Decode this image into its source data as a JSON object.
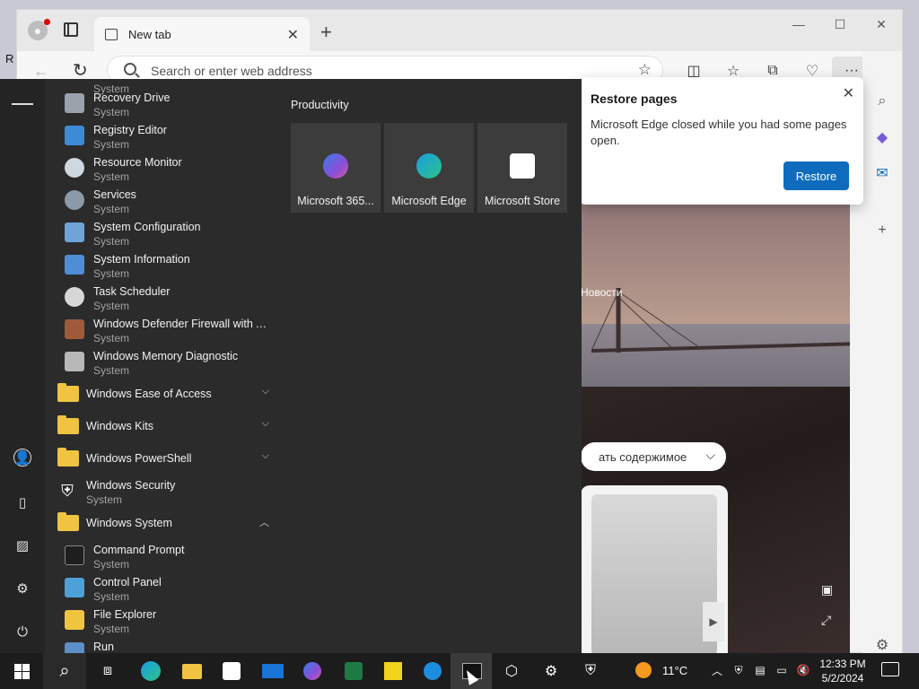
{
  "browser": {
    "tab_title": "New tab",
    "address_placeholder": "Search or enter web address",
    "content": {
      "news_label": "Новости",
      "language_pill": "ать содержимое"
    }
  },
  "restore_popup": {
    "title": "Restore pages",
    "message": "Microsoft Edge closed while you had some pages open.",
    "button": "Restore"
  },
  "start_menu": {
    "apps_top": [
      {
        "name": "Recovery Drive",
        "sub": "System",
        "icon_color": "#9aa3ad"
      },
      {
        "name": "Registry Editor",
        "sub": "System",
        "icon_color": "#3d8ad6"
      },
      {
        "name": "Resource Monitor",
        "sub": "System",
        "icon_color": "#cfd7df"
      },
      {
        "name": "Services",
        "sub": "System",
        "icon_color": "#8a9aa8"
      },
      {
        "name": "System Configuration",
        "sub": "System",
        "icon_color": "#6ea4d8"
      },
      {
        "name": "System Information",
        "sub": "System",
        "icon_color": "#4f8ed6"
      },
      {
        "name": "Task Scheduler",
        "sub": "System",
        "icon_color": "#d7d7d7"
      },
      {
        "name": "Windows Defender Firewall with Ad...",
        "sub": "System",
        "icon_color": "#a05a3a"
      },
      {
        "name": "Windows Memory Diagnostic",
        "sub": "System",
        "icon_color": "#b8b8b8"
      }
    ],
    "folders": {
      "ease_of_access": "Windows Ease of Access",
      "kits": "Windows Kits",
      "powershell": "Windows PowerShell",
      "system": "Windows System"
    },
    "windows_security": {
      "name": "Windows Security",
      "sub": "System"
    },
    "system_apps": [
      {
        "name": "Command Prompt",
        "sub": "System",
        "icon_color": "#1e1e1e"
      },
      {
        "name": "Control Panel",
        "sub": "System",
        "icon_color": "#4ea0d8"
      },
      {
        "name": "File Explorer",
        "sub": "System",
        "icon_color": "#f0c341"
      },
      {
        "name": "Run",
        "sub": "",
        "icon_color": "#5d8fc9"
      }
    ],
    "productivity_title": "Productivity",
    "tiles": [
      {
        "label": "Microsoft 365...",
        "color": "#5b6ee0"
      },
      {
        "label": "Microsoft Edge",
        "color": "#1b9de0"
      },
      {
        "label": "Microsoft Store",
        "color": "#ffffff"
      }
    ]
  },
  "taskbar": {
    "temperature": "11°C",
    "time": "12:33 PM",
    "date": "5/2/2024"
  }
}
